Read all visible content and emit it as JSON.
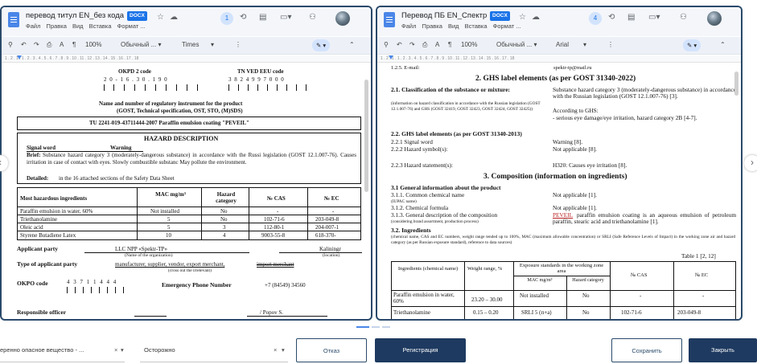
{
  "left_window": {
    "title": "перевод титул EN_без кода",
    "badge": "DOCX",
    "menu": [
      "Файл",
      "Правка",
      "Вид",
      "Вставка",
      "Формат ..."
    ],
    "collab_count": "1",
    "zoom": "100%",
    "style_select": "Обычный ... ▾",
    "font_select": "Times",
    "ruler": "1 . 2 . 1 . 1 . 2 . 3 . 4 . 5 . 6 . 7 . 8 . 9 . 10 . 11 . 12 . 13 . 14 . 15 . 16 . 17 . 18",
    "doc": {
      "okpd_label": "OKPD 2 code",
      "okpd_digits": "2 0 - 1 6 . 3 0 . 1 9 0",
      "tnved_label": "TN VED EEU code",
      "tnved_digits": "3 8 2 4 9 9 7 0 0 0",
      "reg_title": "Name and number of regulatory instrument for the product",
      "reg_subtitle": "(GOST, Technical specification, OST, STO, (M)SDS)",
      "tu": "TU 2241-019-43711444-2007 Paraffin emulsion coating \"PEVEIL\"",
      "hazard_title": "HAZARD DESCRIPTION",
      "signal_word_label": "Signal word",
      "signal_word_value": "Warning",
      "brief_label": "Brief:",
      "brief_text": "Substance hazard category 3 (moderately-dangerous substance) in accordance with the Russi legislation (GOST 12.1.007-76). Causes irritation in case of contact with eyes. Slowly combustible substanc May pollute the environment.",
      "detailed_label": "Detailed:",
      "detailed_text": "in the 16 attached sections of the Safety Data Sheet",
      "table_headers": [
        "Most hazardous ingredients",
        "MAC mg/m³",
        "Hazard category",
        "№ CAS",
        "№ EC"
      ],
      "table_rows": [
        [
          "Paraffin emulsion in water, 60%",
          "Not installed",
          "No",
          "-",
          "-"
        ],
        [
          "Triethanolamine",
          "5",
          "No",
          "102-71-6",
          "203-049-8"
        ],
        [
          "Oleic acid",
          "5",
          "3",
          "112-80-1",
          "204-007-1"
        ],
        [
          "Styrene Butadiene Latex",
          "10",
          "4",
          "9003-55-8",
          "618-370-"
        ]
      ],
      "applicant_label": "Applicant party",
      "applicant_value": "LLC NPP «Spektr-TP»",
      "applicant_location": "Kaliningr",
      "org_caption": "(Name of the organization)",
      "location_caption": "(location)",
      "type_label": "Type of applicant party",
      "type_value": "manufacturer, supplier, vendor, export merchant,",
      "type_struck": "import merchant",
      "cross_out_caption": "(cross out the irrelevant)",
      "okpo_label": "OKPO code",
      "okpo_digits": "4 3 7 1 1 4 4 4",
      "emergency_label": "Emergency Phone Number",
      "emergency_value": "+7 (84549) 34560",
      "officer_label": "Responsible officer",
      "officer_value": "/ Popov S."
    }
  },
  "right_window": {
    "title": "Перевод ПБ EN_Спектр",
    "badge": "DOCX",
    "menu": [
      "Файл",
      "Правка",
      "Вид",
      "Вставка",
      "Формат ..."
    ],
    "collab_count": "4",
    "zoom": "100%",
    "style_select": "Обычный ... ▾",
    "font_select": "Arial",
    "ruler": "1 . 2 . 1 . 1 . 2 . 3 . 4 . 5 . 6 . 7 . 8 . 9 . 10 . 11 . 12 . 13 . 14 . 15 . 16 . 17 . 18",
    "doc": {
      "email_label": "1.2.5. E-mail:",
      "email_value": "spektr-tp@mail.ru",
      "sec2_title": "2. GHS label elements (as per GOST 31340-2022)",
      "s21_label": "2.1. Classification of the substance or mixture:",
      "s21_note": "(information on hazard classification in accordance with the Russian legislation (GOST 12.1.007-76) and GHS (GOST 32419, GOST 32423, GOST 32424, GOST 32425))",
      "s21_value": "Substance hazard category 3 (moderately-dangerous substance) in accordance with the Russian legislation (GOST 12.1.007-76) [3].",
      "s21_ghs": "According to GHS:",
      "s21_ghs_value": "- serious eye damage/eye irritation, hazard category 2B [4-7].",
      "s22_title": "2.2. GHS label elements (as per GOST 31340-2013)",
      "s221_label": "2.2.1 Signal word",
      "s221_value": "Warning [8].",
      "s222_label": "2.2.2 Hazard symbol(s):",
      "s222_value": "Not applicable [8].",
      "s223_label": "2.2.3 Hazard statement(s):",
      "s223_value": "H320: Causes eye irritation [8].",
      "sec3_title": "3. Composition (information on ingredients)",
      "s31_title": "3.1 General information about the product",
      "s311_label": "3.1.1. Common chemical name",
      "s311_note": "(IUPAC name)",
      "s311_value": "Not applicable [1].",
      "s312_label": "3.1.2. Chemical formula",
      "s312_value": "Not applicable [1].",
      "s313_label": "3.1.3. General description of the composition",
      "s313_note": "(considering brand assortment, production process)",
      "s313_value_u": "PEVEIL",
      "s313_value": "paraffin emulsion coating is an aqueous emulsion of petroleum paraffin, stearic acid and triethanolamine [1].",
      "s32_title": "3.2. Ingredients",
      "s32_note": "(chemical name, CAS and EC numbers, weight range tended up to 100%, MAC (maximum allowable concentration) or SRLI (Safe Reference Levels of Impact) in the working zone air and hazard category (as per Russian exposure standard), reference to data sources)",
      "table_caption": "Table 1 [2, 12]",
      "th_ingredients": "Ingredients (chemical name)",
      "th_weight": "Weight range, %",
      "th_exposure": "Exposure standards in the working zone area",
      "th_mac": "MAC mg/m³",
      "th_hazard": "Hazard category",
      "th_cas": "№ CAS",
      "th_ec": "№ EC",
      "rows": [
        [
          "Paraffin emulsion in water, 60%",
          "23.20 – 30.00",
          "Not installed",
          "No",
          "-",
          "-"
        ],
        [
          "Triethanolamine",
          "0.15 – 0.20",
          "SRLI 5 (п+а)",
          "No",
          "102-71-6",
          "203-049-8"
        ]
      ]
    }
  },
  "bottom_bar": {
    "select1": "еренно опасное вещество - ...",
    "select2": "Осторожно",
    "btn_back": "Отказ",
    "btn_register": "Регистрация",
    "btn_save": "Сохранить",
    "btn_close": "Закрыть"
  },
  "colors": {
    "accent": "#1a73e8",
    "primary_button": "#1e3a60",
    "panel_border": "#2a4a6a"
  },
  "icons": [
    "doc-icon",
    "star-icon",
    "cloud-icon",
    "history-icon",
    "comment-icon",
    "video-icon",
    "share-icon",
    "search-icon",
    "undo-icon",
    "redo-icon",
    "print-icon",
    "spellcheck-icon",
    "paint-format-icon",
    "expand-icon",
    "chevron-left-icon",
    "chevron-right-icon"
  ]
}
